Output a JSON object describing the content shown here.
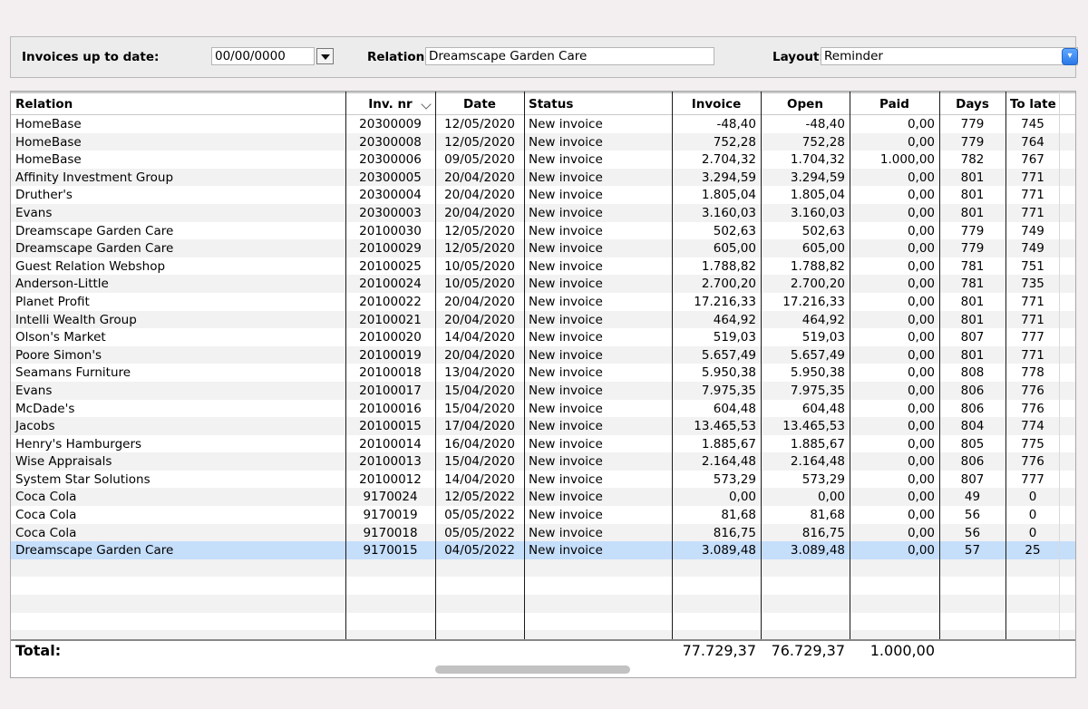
{
  "toolbar": {
    "date_label": "Invoices up to date:",
    "date_value": "00/00/0000",
    "relation_label": "Relation:",
    "relation_value": "Dreamscape Garden Care",
    "layout_label": "Layout:",
    "layout_value": "Reminder"
  },
  "table": {
    "columns": [
      "Relation",
      "Inv. nr",
      "Date",
      "Status",
      "Invoice",
      "Open",
      "Paid",
      "Days",
      "To late"
    ],
    "rows": [
      [
        "HomeBase",
        "20300009",
        "12/05/2020",
        "New invoice",
        "-48,40",
        "-48,40",
        "0,00",
        "779",
        "745"
      ],
      [
        "HomeBase",
        "20300008",
        "12/05/2020",
        "New invoice",
        "752,28",
        "752,28",
        "0,00",
        "779",
        "764"
      ],
      [
        "HomeBase",
        "20300006",
        "09/05/2020",
        "New invoice",
        "2.704,32",
        "1.704,32",
        "1.000,00",
        "782",
        "767"
      ],
      [
        "Affinity Investment Group",
        "20300005",
        "20/04/2020",
        "New invoice",
        "3.294,59",
        "3.294,59",
        "0,00",
        "801",
        "771"
      ],
      [
        "Druther's",
        "20300004",
        "20/04/2020",
        "New invoice",
        "1.805,04",
        "1.805,04",
        "0,00",
        "801",
        "771"
      ],
      [
        "Evans",
        "20300003",
        "20/04/2020",
        "New invoice",
        "3.160,03",
        "3.160,03",
        "0,00",
        "801",
        "771"
      ],
      [
        "Dreamscape Garden Care",
        "20100030",
        "12/05/2020",
        "New invoice",
        "502,63",
        "502,63",
        "0,00",
        "779",
        "749"
      ],
      [
        "Dreamscape Garden Care",
        "20100029",
        "12/05/2020",
        "New invoice",
        "605,00",
        "605,00",
        "0,00",
        "779",
        "749"
      ],
      [
        "Guest Relation Webshop",
        "20100025",
        "10/05/2020",
        "New invoice",
        "1.788,82",
        "1.788,82",
        "0,00",
        "781",
        "751"
      ],
      [
        "Anderson-Little",
        "20100024",
        "10/05/2020",
        "New invoice",
        "2.700,20",
        "2.700,20",
        "0,00",
        "781",
        "735"
      ],
      [
        "Planet Profit",
        "20100022",
        "20/04/2020",
        "New invoice",
        "17.216,33",
        "17.216,33",
        "0,00",
        "801",
        "771"
      ],
      [
        "Intelli Wealth Group",
        "20100021",
        "20/04/2020",
        "New invoice",
        "464,92",
        "464,92",
        "0,00",
        "801",
        "771"
      ],
      [
        "Olson's Market",
        "20100020",
        "14/04/2020",
        "New invoice",
        "519,03",
        "519,03",
        "0,00",
        "807",
        "777"
      ],
      [
        "Poore Simon's",
        "20100019",
        "20/04/2020",
        "New invoice",
        "5.657,49",
        "5.657,49",
        "0,00",
        "801",
        "771"
      ],
      [
        "Seamans Furniture",
        "20100018",
        "13/04/2020",
        "New invoice",
        "5.950,38",
        "5.950,38",
        "0,00",
        "808",
        "778"
      ],
      [
        "Evans",
        "20100017",
        "15/04/2020",
        "New invoice",
        "7.975,35",
        "7.975,35",
        "0,00",
        "806",
        "776"
      ],
      [
        "McDade's",
        "20100016",
        "15/04/2020",
        "New invoice",
        "604,48",
        "604,48",
        "0,00",
        "806",
        "776"
      ],
      [
        "Jacobs",
        "20100015",
        "17/04/2020",
        "New invoice",
        "13.465,53",
        "13.465,53",
        "0,00",
        "804",
        "774"
      ],
      [
        "Henry's Hamburgers",
        "20100014",
        "16/04/2020",
        "New invoice",
        "1.885,67",
        "1.885,67",
        "0,00",
        "805",
        "775"
      ],
      [
        "Wise Appraisals",
        "20100013",
        "15/04/2020",
        "New invoice",
        "2.164,48",
        "2.164,48",
        "0,00",
        "806",
        "776"
      ],
      [
        "System Star Solutions",
        "20100012",
        "14/04/2020",
        "New invoice",
        "573,29",
        "573,29",
        "0,00",
        "807",
        "777"
      ],
      [
        "Coca Cola",
        "9170024",
        "12/05/2022",
        "New invoice",
        "0,00",
        "0,00",
        "0,00",
        "49",
        "0"
      ],
      [
        "Coca Cola",
        "9170019",
        "05/05/2022",
        "New invoice",
        "81,68",
        "81,68",
        "0,00",
        "56",
        "0"
      ],
      [
        "Coca Cola",
        "9170018",
        "05/05/2022",
        "New invoice",
        "816,75",
        "816,75",
        "0,00",
        "56",
        "0"
      ],
      [
        "Dreamscape Garden Care",
        "9170015",
        "04/05/2022",
        "New invoice",
        "3.089,48",
        "3.089,48",
        "0,00",
        "57",
        "25"
      ]
    ],
    "selected_row": 24,
    "total_label": "Total:",
    "total_invoice": "77.729,37",
    "total_open": "76.729,37",
    "total_paid": "1.000,00"
  },
  "colors": {
    "selection": "#c5defa",
    "alt_row": "#f2f2f2"
  }
}
